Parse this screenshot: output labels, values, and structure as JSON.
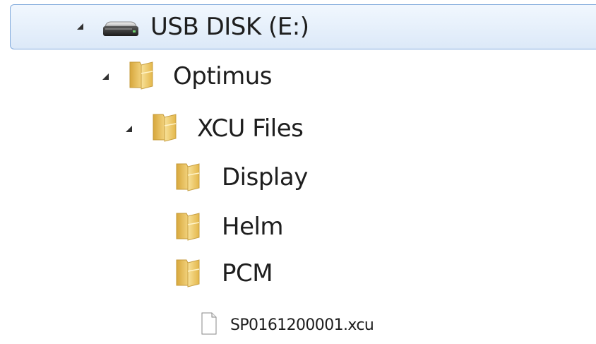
{
  "tree": {
    "drive": {
      "label": "USB DISK (E:)",
      "icon": "usb-drive-icon",
      "expanded": true,
      "selected": true
    },
    "optimus": {
      "label": "Optimus",
      "icon": "folder-icon",
      "expanded": true
    },
    "xcu_files": {
      "label": "XCU Files",
      "icon": "folder-icon",
      "expanded": true
    },
    "display": {
      "label": "Display",
      "icon": "folder-icon"
    },
    "helm": {
      "label": "Helm",
      "icon": "folder-icon"
    },
    "pcm": {
      "label": "PCM",
      "icon": "folder-icon"
    },
    "file": {
      "label": "SP0161200001.xcu",
      "icon": "document-icon"
    }
  },
  "colors": {
    "selection_border": "#84acdd",
    "selection_fill": "#dce9f8",
    "folder": "#e9c25a"
  }
}
